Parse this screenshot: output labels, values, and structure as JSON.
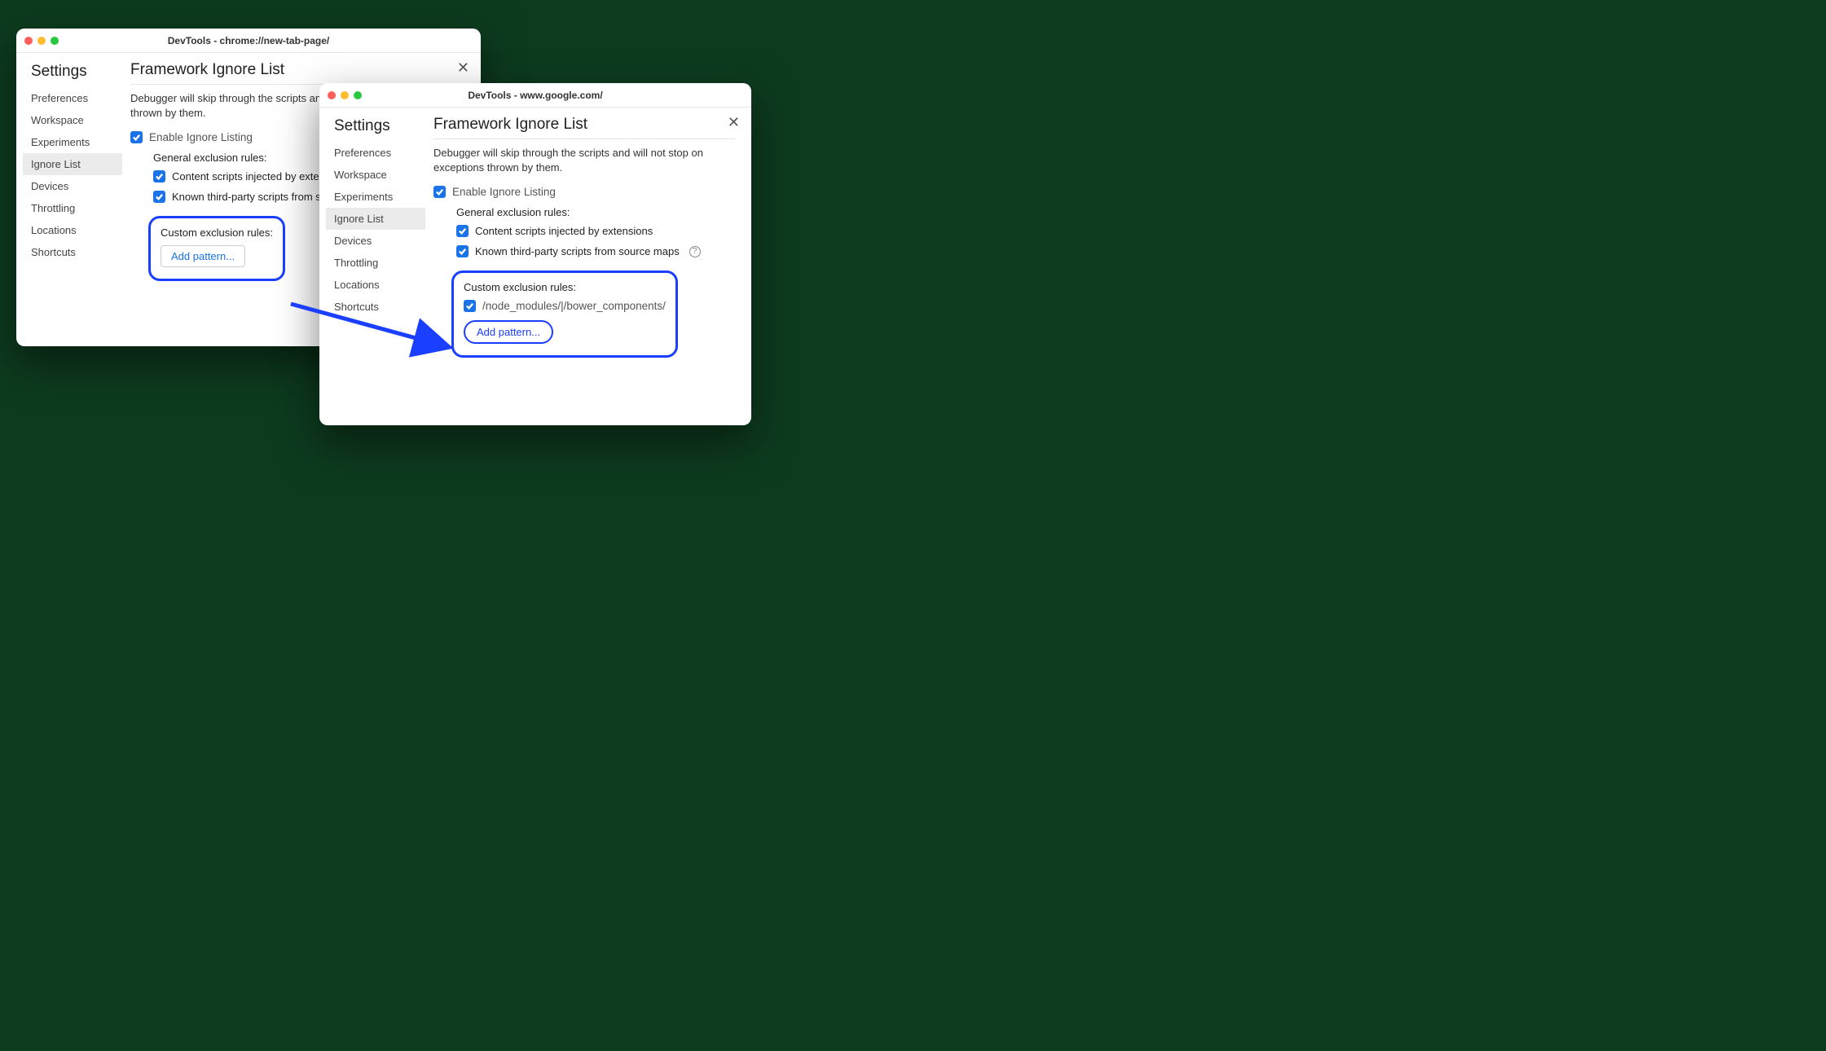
{
  "window1": {
    "title": "DevTools - chrome://new-tab-page/",
    "sidebar_title": "Settings",
    "sidebar": [
      "Preferences",
      "Workspace",
      "Experiments",
      "Ignore List",
      "Devices",
      "Throttling",
      "Locations",
      "Shortcuts"
    ],
    "section_title": "Framework Ignore List",
    "desc": "Debugger will skip through the scripts and will not stop on exceptions thrown by them.",
    "enable_label": "Enable Ignore Listing",
    "general_label": "General exclusion rules:",
    "rule1": "Content scripts injected by extensions",
    "rule2": "Known third-party scripts from source maps",
    "custom_label": "Custom exclusion rules:",
    "add_label": "Add pattern..."
  },
  "window2": {
    "title": "DevTools - www.google.com/",
    "sidebar_title": "Settings",
    "sidebar": [
      "Preferences",
      "Workspace",
      "Experiments",
      "Ignore List",
      "Devices",
      "Throttling",
      "Locations",
      "Shortcuts"
    ],
    "section_title": "Framework Ignore List",
    "desc": "Debugger will skip through the scripts and will not stop on exceptions thrown by them.",
    "enable_label": "Enable Ignore Listing",
    "general_label": "General exclusion rules:",
    "rule1": "Content scripts injected by extensions",
    "rule2": "Known third-party scripts from source maps",
    "custom_label": "Custom exclusion rules:",
    "pattern": "/node_modules/|/bower_components/",
    "add_label": "Add pattern..."
  }
}
